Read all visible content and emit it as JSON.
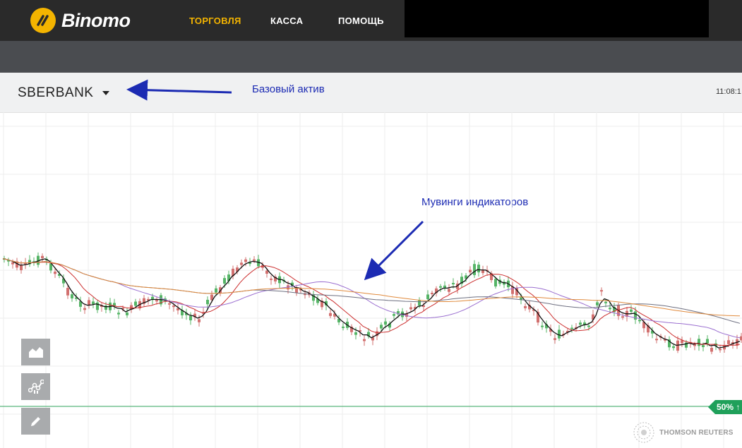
{
  "header": {
    "logo_text": "Binomo",
    "nav": [
      {
        "label": "ТОРГОВЛЯ",
        "active": true
      },
      {
        "label": "КАССА",
        "active": false
      },
      {
        "label": "ПОМОЩЬ",
        "active": false
      }
    ]
  },
  "asset_bar": {
    "asset_name": "SBERBANK",
    "time": "11:08:1"
  },
  "annotations": {
    "base_asset": "Базовый актив",
    "moving_averages": "Мувинги индикаторов"
  },
  "chart": {
    "payout_badge": "50% ↑",
    "watermark": "THOMSON REUTERS"
  },
  "tools": [
    "area-chart-icon",
    "indicators-icon",
    "pencil-icon"
  ],
  "colors": {
    "accent": "#f4b400",
    "header_bg": "#2a2a2a",
    "subbar_bg": "#4a4c50",
    "bull": "#55b466",
    "bear": "#d2706f",
    "annotation": "#1c2bb3",
    "payout": "#1fa05a"
  }
}
